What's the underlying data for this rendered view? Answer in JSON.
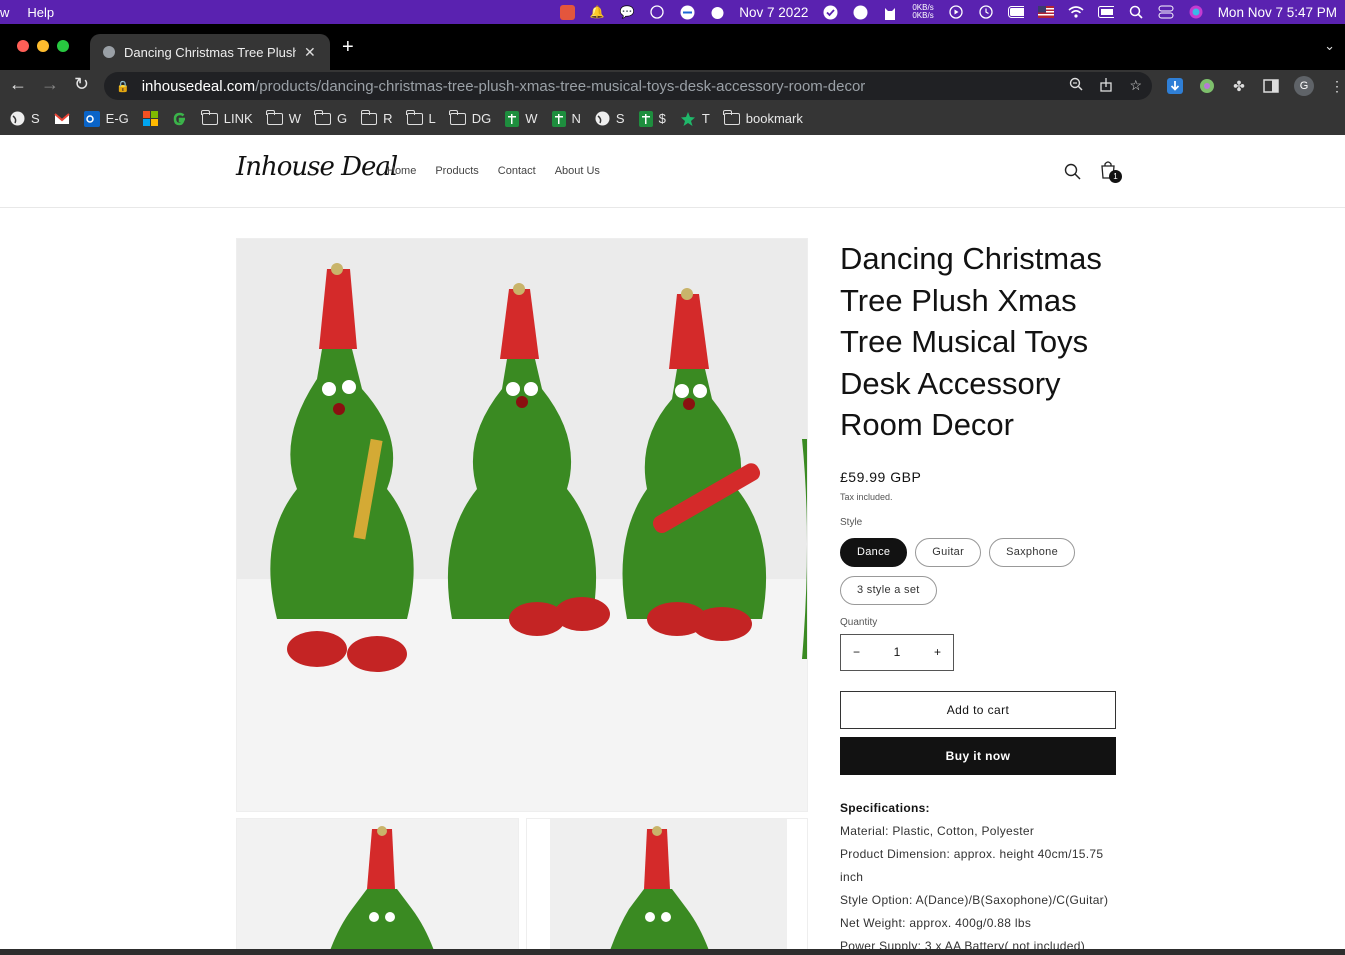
{
  "menubar": {
    "app_fragment": "w",
    "help": "Help",
    "net_up": "0KB/s",
    "net_down": "0KB/s",
    "date_widget": "Nov 7 2022",
    "clock": "Mon Nov 7  5:47 PM"
  },
  "browser": {
    "tab_title": "Dancing Christmas Tree Plush Xmas Tree Musical Toys",
    "url_host": "inhousedeal.com",
    "url_path": "/products/dancing-christmas-tree-plush-xmas-tree-musical-toys-desk-accessory-room-decor",
    "profile_initial": "G",
    "bookmarks": [
      {
        "label": "S",
        "icon": "globe-icon"
      },
      {
        "label": "",
        "icon": "gmail-icon"
      },
      {
        "label": "E-G",
        "icon": "outlook-icon"
      },
      {
        "label": "",
        "icon": "microsoft-icon"
      },
      {
        "label": "",
        "icon": "g-icon"
      },
      {
        "label": "LINK",
        "icon": "folder-icon"
      },
      {
        "label": "W",
        "icon": "folder-icon"
      },
      {
        "label": "G",
        "icon": "folder-icon"
      },
      {
        "label": "R",
        "icon": "folder-icon"
      },
      {
        "label": "L",
        "icon": "folder-icon"
      },
      {
        "label": "DG",
        "icon": "folder-icon"
      },
      {
        "label": "W",
        "icon": "sheets-icon"
      },
      {
        "label": "N",
        "icon": "sheets-icon"
      },
      {
        "label": "S",
        "icon": "globe-icon"
      },
      {
        "label": "$",
        "icon": "sheets-icon"
      },
      {
        "label": "T",
        "icon": "star-icon"
      },
      {
        "label": "bookmark",
        "icon": "folder-icon"
      }
    ]
  },
  "site": {
    "logo": "Inhouse Deal",
    "nav": [
      "Home",
      "Products",
      "Contact",
      "About Us"
    ],
    "cart_count": "1"
  },
  "product": {
    "title": "Dancing Christmas Tree Plush Xmas Tree Musical Toys Desk Accessory Room Decor",
    "price": "£59.99 GBP",
    "tax_note": "Tax included.",
    "style_label": "Style",
    "styles": [
      "Dance",
      "Guitar",
      "Saxphone",
      "3 style a set"
    ],
    "selected_style": "Dance",
    "quantity_label": "Quantity",
    "quantity": "1",
    "add_to_cart": "Add to cart",
    "buy_now": "Buy it now",
    "specs_heading": "Specifications:",
    "specs": [
      "Material: Plastic, Cotton, Polyester",
      "Product Dimension: approx. height 40cm/15.75 inch",
      "Style Option: A(Dance)/B(Saxophone)/C(Guitar)",
      "Net Weight: approx. 400g/0.88 lbs",
      "Power Supply: 3 x AA Battery( not included)"
    ]
  },
  "colors": {
    "menubar": "#5a22b0",
    "chrome_dark": "#353535",
    "button_dark": "#121212",
    "tree_green": "#3a8a22",
    "hat_red": "#d42a2a"
  }
}
